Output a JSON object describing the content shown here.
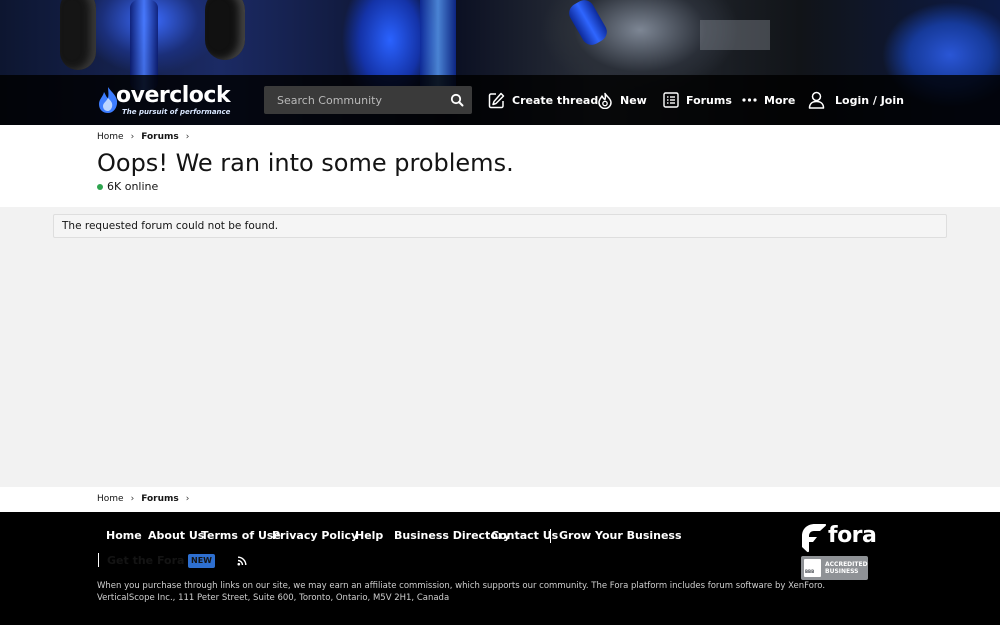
{
  "header": {
    "logo_text": "overclock",
    "logo_tagline": "The pursuit of performance",
    "search_placeholder": "Search Community",
    "nav": {
      "create_thread": "Create thread",
      "new": "New",
      "forums": "Forums",
      "more": "More",
      "login": "Login / Join"
    }
  },
  "breadcrumb": {
    "home": "Home",
    "forums": "Forums"
  },
  "page": {
    "title": "Oops! We ran into some problems.",
    "online_count": "6K online",
    "message": "The requested forum could not be found."
  },
  "footer": {
    "links": {
      "home": "Home",
      "about": "About Us",
      "terms": "Terms of Use",
      "privacy": "Privacy Policy",
      "help": "Help",
      "business_directory": "Business Directory",
      "contact": "Contact Us",
      "grow": "Grow Your Business"
    },
    "app_link": "Get the Fora App",
    "new_badge": "NEW",
    "legal_line1": "When you purchase through links on our site, we may earn an affiliate commission, which supports our community. The Fora platform includes forum software by XenForo.",
    "legal_line2": "VerticalScope Inc., 111 Peter Street, Suite 600, Toronto, Ontario, M5V 2H1, Canada",
    "fora_logo": "fora",
    "bbb_label_1": "ACCREDITED",
    "bbb_label_2": "BUSINESS",
    "bbb_seal": "BBB"
  },
  "colors": {
    "online_dot": "#2ea44f",
    "new_badge": "#2e6fcf",
    "navbar": "#000000"
  }
}
